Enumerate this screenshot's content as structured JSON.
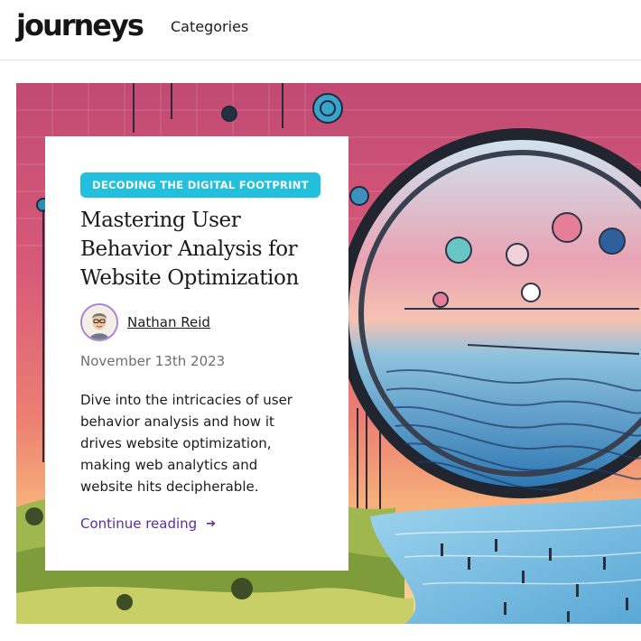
{
  "header": {
    "logo": "journeys",
    "nav": {
      "categories": "Categories"
    }
  },
  "hero": {
    "image_alt": "Illustration of a digital landscape with data icons seen through a large lens",
    "colors": {
      "sky_top": "#c9476d",
      "sky_mid": "#e3627d",
      "horizon": "#f29a6b",
      "hills": "#8fae4a",
      "water": "#6fb8de",
      "lens_rim": "#2b2f3d"
    }
  },
  "article": {
    "category": "DECODING THE DIGITAL FOOTPRINT",
    "title": "Mastering User Behavior Analysis for Website Optimization",
    "author": {
      "name": "Nathan Reid",
      "avatar_icon": "user-avatar-icon"
    },
    "date": "November 13th 2023",
    "excerpt": "Dive into the intricacies of user behavior analysis and how it drives website optimization, making web analytics and website hits decipherable.",
    "cta": {
      "label": "Continue reading",
      "icon": "arrow-right-icon"
    },
    "colors": {
      "badge": "#22c0dc",
      "link": "#5b2d9e",
      "avatar_ring": "#a985d6"
    }
  }
}
